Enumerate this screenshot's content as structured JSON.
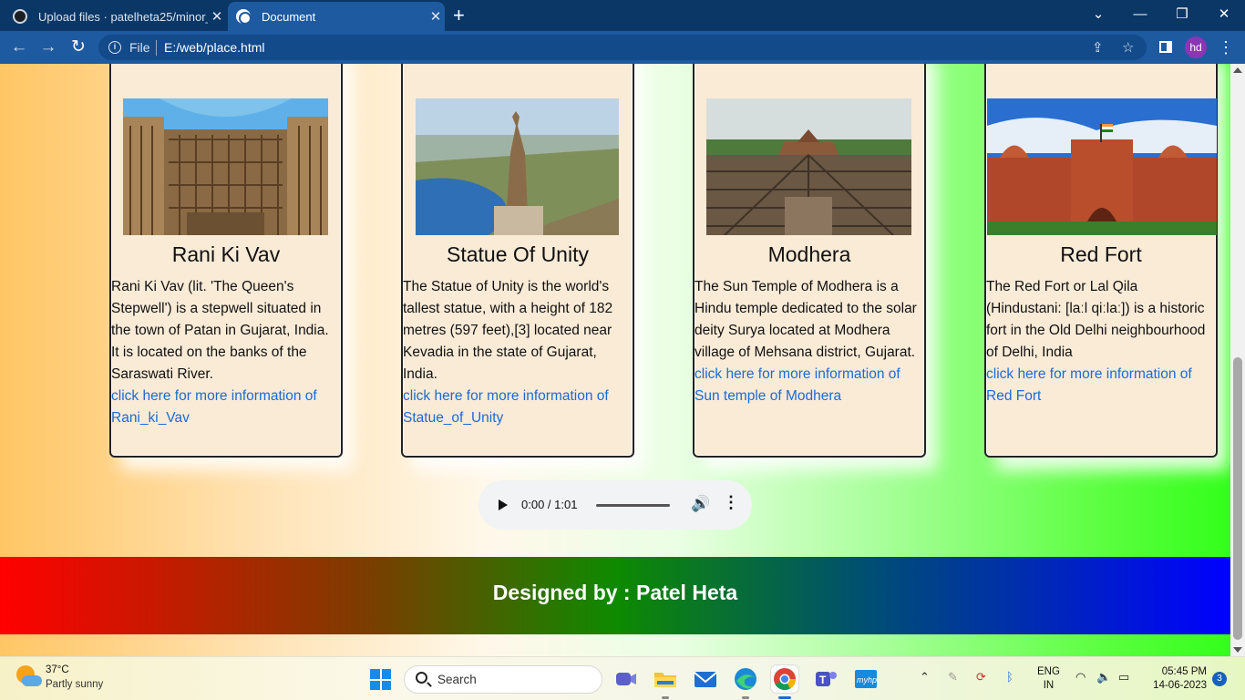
{
  "browser": {
    "tabs": [
      {
        "title": "Upload files · patelheta25/minor_",
        "close": "✕"
      },
      {
        "title": "Document",
        "close": "✕"
      }
    ],
    "new_tab": "+",
    "window_controls": {
      "dropdown": "⌄",
      "minimize": "—",
      "restore": "❐",
      "close": "✕"
    },
    "nav": {
      "back": "←",
      "forward": "→",
      "reload": "↻"
    },
    "address": {
      "info_icon": "i",
      "scheme_label": "File",
      "url": "E:/web/place.html"
    },
    "profile_initials": "hd",
    "icons": [
      "share-icon",
      "star-icon",
      "side-panel-icon",
      "menu-icon"
    ]
  },
  "cards": [
    {
      "title": "Rani Ki Vav",
      "description": "Rani Ki Vav (lit. 'The Queen's Stepwell') is a stepwell situated in the town of Patan in Gujarat, India. It is located on the banks of the Saraswati River.",
      "link_text": "click here for more information of Rani_ki_Vav"
    },
    {
      "title": "Statue Of Unity",
      "description": "The Statue of Unity is the world's tallest statue, with a height of 182 metres (597 feet),[3] located near Kevadia in the state of Gujarat, India.",
      "link_text": "click here for more information of Statue_of_Unity"
    },
    {
      "title": "Modhera",
      "description": "The Sun Temple of Modhera is a Hindu temple dedicated to the solar deity Surya located at Modhera village of Mehsana district, Gujarat.",
      "link_text": "click here for more information of Sun temple of Modhera"
    },
    {
      "title": "Red Fort",
      "description": "The Red Fort or Lal Qila (Hindustani: [laːl qiːlaː]) is a historic fort in the Old Delhi neighbourhood of Delhi, India",
      "link_text": "click here for more information of Red Fort"
    }
  ],
  "audio": {
    "time": "0:00 / 1:01",
    "progress": 0
  },
  "footer": {
    "text": "Designed by : Patel Heta"
  },
  "taskbar": {
    "weather_temp": "37°C",
    "weather_desc": "Partly sunny",
    "search_label": "Search",
    "lang_line1": "ENG",
    "lang_line2": "IN",
    "time": "05:45 PM",
    "date": "14-06-2023",
    "notifications": "3",
    "apps": [
      "teams-meet-icon",
      "file-explorer-icon",
      "mail-icon",
      "edge-icon",
      "chrome-icon",
      "teams-icon",
      "myhp-icon"
    ]
  }
}
